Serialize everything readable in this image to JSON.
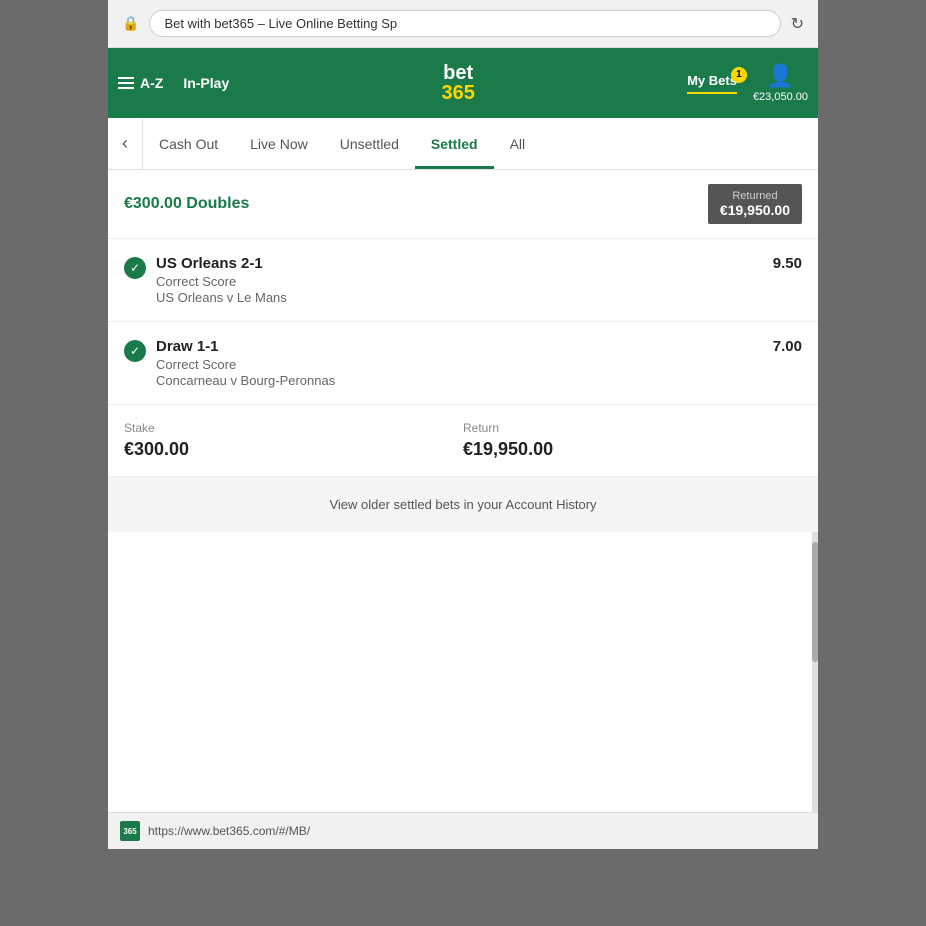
{
  "browser": {
    "url": "Bet with bet365 – Live Online Betting Sp",
    "favicon_label": "365"
  },
  "nav": {
    "az_label": "A-Z",
    "inplay_label": "In-Play",
    "logo_bet": "bet",
    "logo_365": "365",
    "mybets_label": "My Bets",
    "mybets_badge": "1",
    "account_balance": "€23,050.00"
  },
  "tabs": {
    "cash_out": "Cash Out",
    "live_now": "Live Now",
    "unsettled": "Unsettled",
    "settled": "Settled",
    "all": "All"
  },
  "bet": {
    "title": "€300.00 Doubles",
    "returned_label": "Returned",
    "returned_amount": "€19,950.00",
    "items": [
      {
        "outcome": "US Orleans 2-1",
        "type": "Correct Score",
        "match": "US Orleans v Le Mans",
        "odds": "9.50"
      },
      {
        "outcome": "Draw 1-1",
        "type": "Correct Score",
        "match": "Concarneau v Bourg-Peronnas",
        "odds": "7.00"
      }
    ],
    "stake_label": "Stake",
    "stake_value": "€300.00",
    "return_label": "Return",
    "return_value": "€19,950.00"
  },
  "footer": {
    "link_text": "View older settled bets in your Account History"
  },
  "bottom_bar": {
    "url": "https://www.bet365.com/#/MB/"
  }
}
